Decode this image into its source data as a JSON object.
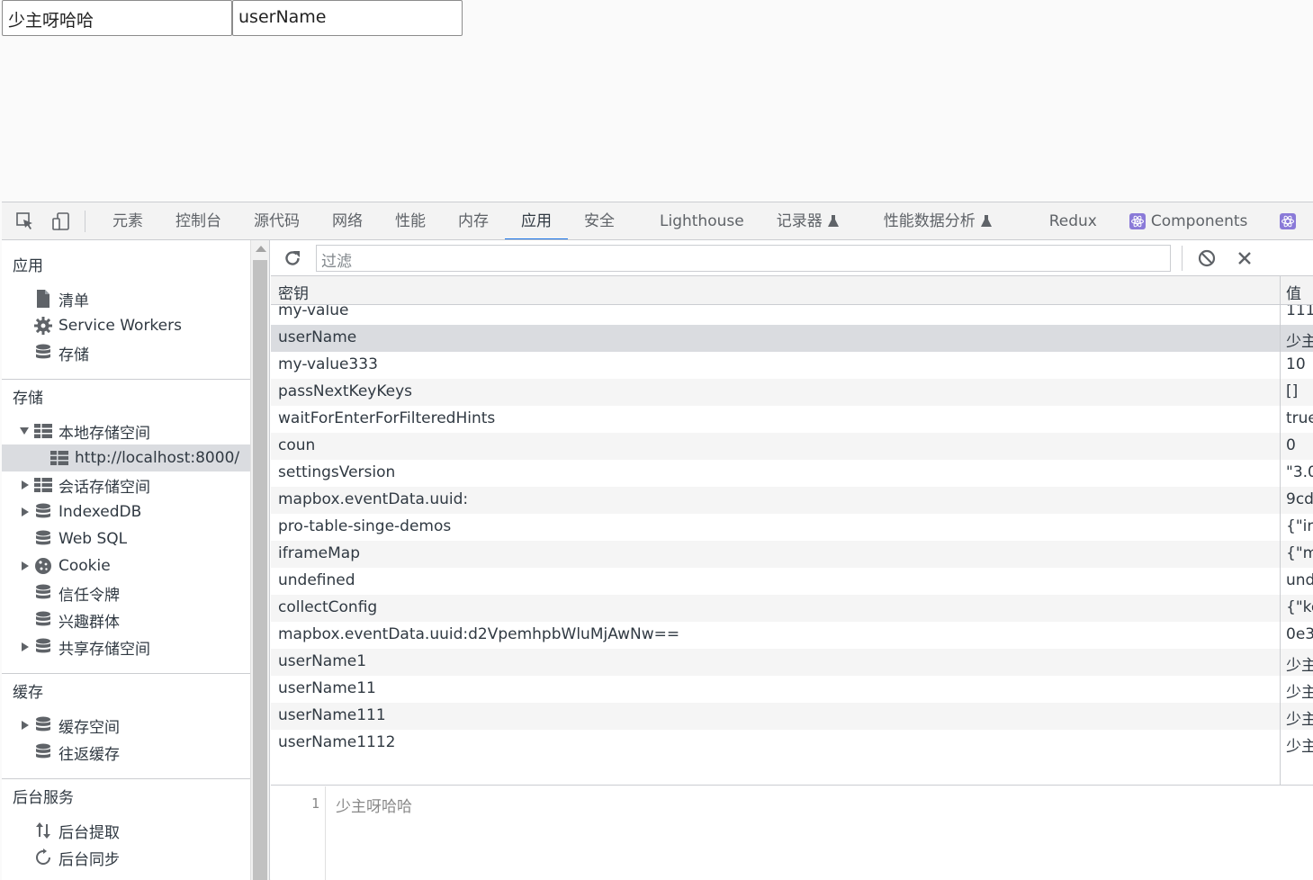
{
  "page": {
    "input_1": "少主呀哈哈",
    "input_2": "userName"
  },
  "devtools": {
    "tabs": [
      {
        "label": "元素"
      },
      {
        "label": "控制台"
      },
      {
        "label": "源代码"
      },
      {
        "label": "网络"
      },
      {
        "label": "性能"
      },
      {
        "label": "内存"
      },
      {
        "label": "应用"
      },
      {
        "label": "安全"
      },
      {
        "label": "Lighthouse"
      },
      {
        "label": "记录器"
      },
      {
        "label": "性能数据分析"
      },
      {
        "label": "Redux"
      },
      {
        "label": "Components"
      }
    ],
    "active_tab": "应用",
    "accent_color": "#1a73e8"
  },
  "sidebar": {
    "app_title": "应用",
    "app_items": [
      {
        "label": "清单",
        "icon": "file-icon"
      },
      {
        "label": "Service Workers",
        "icon": "gear-icon"
      },
      {
        "label": "存储",
        "icon": "database-icon"
      }
    ],
    "storage_title": "存储",
    "storage_items": {
      "local_storage": "本地存储空间",
      "local_origin": "http://localhost:8000/",
      "session_storage": "会话存储空间",
      "indexeddb": "IndexedDB",
      "websql": "Web SQL",
      "cookie": "Cookie",
      "trust_tokens": "信任令牌",
      "interest_groups": "兴趣群体",
      "shared_storage": "共享存储空间"
    },
    "cache_title": "缓存",
    "cache_items": {
      "cache_storage": "缓存空间",
      "bfcache": "往返缓存"
    },
    "background_title": "后台服务",
    "background_items": {
      "fetch": "后台提取",
      "sync": "后台同步"
    }
  },
  "main": {
    "filter_placeholder": "过滤",
    "column_key": "密钥",
    "column_value": "值",
    "rows": [
      {
        "key": "my-value",
        "value": "111"
      },
      {
        "key": "userName",
        "value": "少主"
      },
      {
        "key": "my-value333",
        "value": "10"
      },
      {
        "key": "passNextKeyKeys",
        "value": "[]"
      },
      {
        "key": "waitForEnterForFilteredHints",
        "value": "true"
      },
      {
        "key": "coun",
        "value": "0"
      },
      {
        "key": "settingsVersion",
        "value": "\"3.0"
      },
      {
        "key": "mapbox.eventData.uuid:",
        "value": "9cd"
      },
      {
        "key": "pro-table-singe-demos",
        "value": "{\"in"
      },
      {
        "key": "iframeMap",
        "value": "{\"m"
      },
      {
        "key": "undefined",
        "value": "und"
      },
      {
        "key": "collectConfig",
        "value": "{\"ke"
      },
      {
        "key": "mapbox.eventData.uuid:d2VpemhpbWluMjAwNw==",
        "value": "0e3"
      },
      {
        "key": "userName1",
        "value": "少主"
      },
      {
        "key": "userName11",
        "value": "少主"
      },
      {
        "key": "userName111",
        "value": "少主"
      },
      {
        "key": "userName1112",
        "value": "少主"
      }
    ],
    "selected_row": 1,
    "preview_line_number": "1",
    "preview_text": "少主呀哈哈"
  }
}
